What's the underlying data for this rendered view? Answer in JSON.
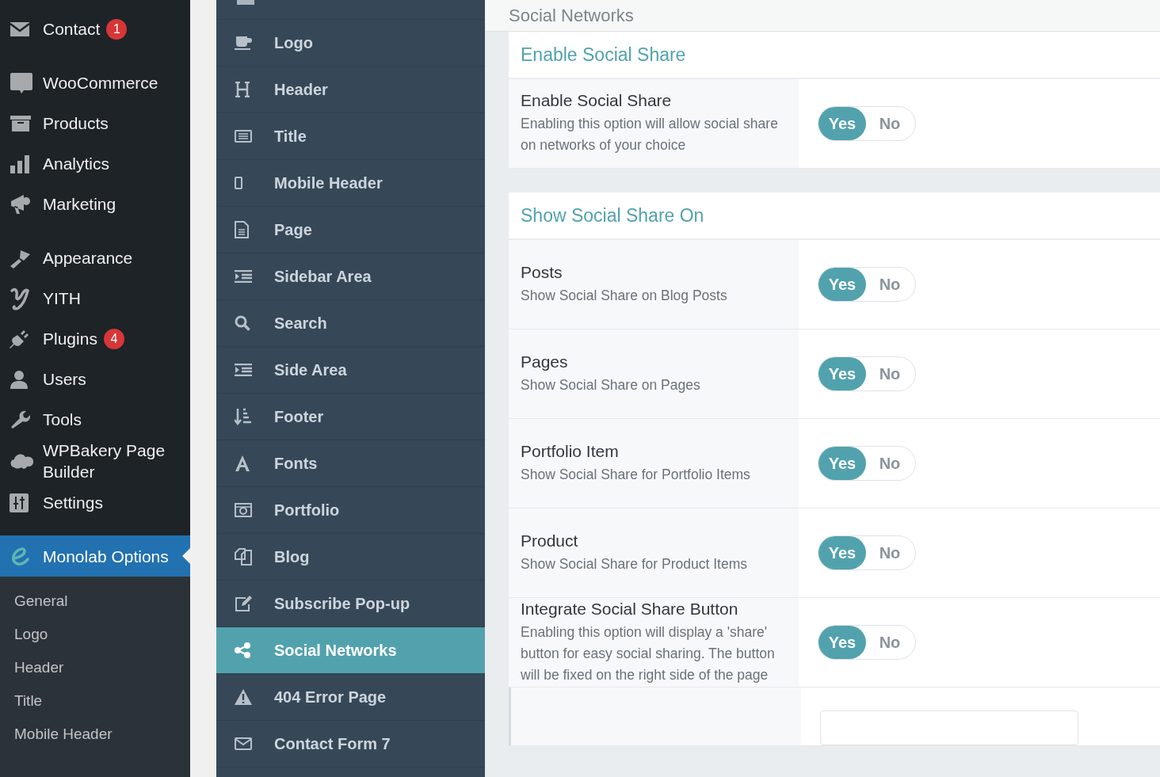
{
  "admin_menu": {
    "groups": [
      [
        {
          "label": "Contact",
          "badge": "1",
          "selected": false
        }
      ],
      [
        {
          "label": "WooCommerce",
          "selected": false
        },
        {
          "label": "Products",
          "selected": false
        },
        {
          "label": "Analytics",
          "selected": false
        },
        {
          "label": "Marketing",
          "selected": false
        }
      ],
      [
        {
          "label": "Appearance",
          "selected": false
        },
        {
          "label": "YITH",
          "selected": false
        },
        {
          "label": "Plugins",
          "badge": "4",
          "selected": false
        },
        {
          "label": "Users",
          "selected": false
        },
        {
          "label": "Tools",
          "selected": false
        },
        {
          "label": "WPBakery Page Builder",
          "selected": false
        },
        {
          "label": "Settings",
          "selected": false
        }
      ],
      [
        {
          "label": "Monolab Options",
          "selected": true
        }
      ]
    ],
    "submenu": [
      "General",
      "Logo",
      "Header",
      "Title",
      "Mobile Header"
    ]
  },
  "options_nav": [
    {
      "label": "Logo",
      "selected": false
    },
    {
      "label": "Header",
      "selected": false
    },
    {
      "label": "Title",
      "selected": false
    },
    {
      "label": "Mobile Header",
      "selected": false
    },
    {
      "label": "Page",
      "selected": false
    },
    {
      "label": "Sidebar Area",
      "selected": false
    },
    {
      "label": "Search",
      "selected": false
    },
    {
      "label": "Side Area",
      "selected": false
    },
    {
      "label": "Footer",
      "selected": false
    },
    {
      "label": "Fonts",
      "selected": false
    },
    {
      "label": "Portfolio",
      "selected": false
    },
    {
      "label": "Blog",
      "selected": false
    },
    {
      "label": "Subscribe Pop-up",
      "selected": false
    },
    {
      "label": "Social Networks",
      "selected": true
    },
    {
      "label": "404 Error Page",
      "selected": false
    },
    {
      "label": "Contact Form 7",
      "selected": false
    }
  ],
  "page_title": "Social Networks",
  "sections": [
    {
      "title": "Enable Social Share",
      "rows": [
        {
          "label": "Enable Social Share",
          "description": "Enabling this option will allow social share on networks of your choice",
          "options": [
            {
              "label": "Yes",
              "selected": true
            },
            {
              "label": "No",
              "selected": false
            }
          ]
        }
      ]
    },
    {
      "title": "Show Social Share On",
      "rows": [
        {
          "label": "Posts",
          "description": "Show Social Share on Blog Posts",
          "options": [
            {
              "label": "Yes",
              "selected": true
            },
            {
              "label": "No",
              "selected": false
            }
          ]
        },
        {
          "label": "Pages",
          "description": "Show Social Share on Pages",
          "options": [
            {
              "label": "Yes",
              "selected": true
            },
            {
              "label": "No",
              "selected": false
            }
          ]
        },
        {
          "label": "Portfolio Item",
          "description": "Show Social Share for Portfolio Items",
          "options": [
            {
              "label": "Yes",
              "selected": true
            },
            {
              "label": "No",
              "selected": false
            }
          ]
        },
        {
          "label": "Product",
          "description": "Show Social Share for Product Items",
          "options": [
            {
              "label": "Yes",
              "selected": true
            },
            {
              "label": "No",
              "selected": false
            }
          ]
        },
        {
          "label": "Integrate Social Share Button",
          "description": "Enabling this option will display a 'share' button for easy social sharing. The button will be fixed on the right side of the page",
          "options": [
            {
              "label": "Yes",
              "selected": true
            },
            {
              "label": "No",
              "selected": false
            }
          ]
        },
        {
          "kind": "input"
        }
      ]
    }
  ]
}
